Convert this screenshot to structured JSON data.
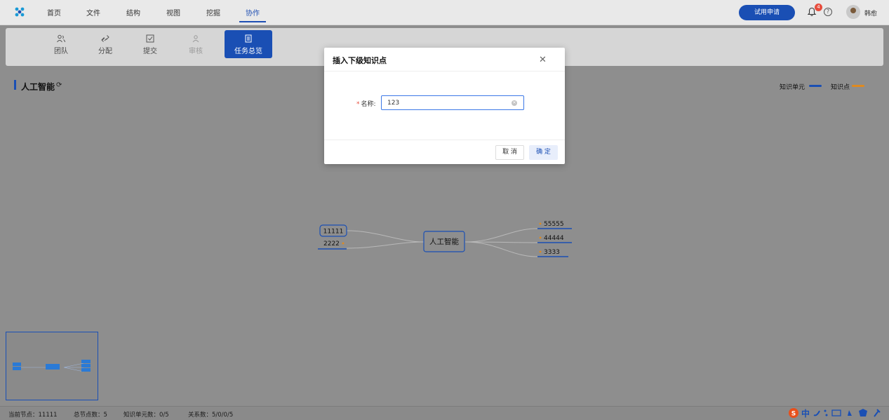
{
  "topnav": {
    "items": [
      {
        "label": "首页"
      },
      {
        "label": "文件"
      },
      {
        "label": "结构"
      },
      {
        "label": "视图"
      },
      {
        "label": "挖掘"
      },
      {
        "label": "协作"
      }
    ],
    "active_item": "协作",
    "trial_button": "试用申请",
    "notification_count": "4",
    "username": "韩愈"
  },
  "toolbar": {
    "items": [
      {
        "label": "团队",
        "icon": "team-icon"
      },
      {
        "label": "分配",
        "icon": "assign-icon"
      },
      {
        "label": "提交",
        "icon": "submit-icon"
      },
      {
        "label": "审核",
        "icon": "review-icon"
      },
      {
        "label": "任务总览",
        "icon": "task-overview-icon"
      }
    ]
  },
  "map": {
    "title": "人工智能",
    "legend": [
      {
        "label": "知识单元",
        "color": "#1a4fb4"
      },
      {
        "label": "知识点",
        "color": "#e08a1e"
      }
    ],
    "nodes": {
      "center": "人工智能",
      "left": [
        "11111",
        "2222"
      ],
      "right": [
        "55555",
        "44444",
        "3333"
      ]
    }
  },
  "status": {
    "current_node": "当前节点：11111",
    "total_nodes": "总节点数：5",
    "knowledge_units": "知识单元数：0/5",
    "relations": "关系数：5/0/0/5"
  },
  "modal": {
    "title": "插入下级知识点",
    "field_label": "名称:",
    "field_value": "123",
    "cancel_label": "取 消",
    "ok_label": "确 定"
  },
  "colors": {
    "accent": "#1a4fb4",
    "point": "#e08a1e"
  }
}
